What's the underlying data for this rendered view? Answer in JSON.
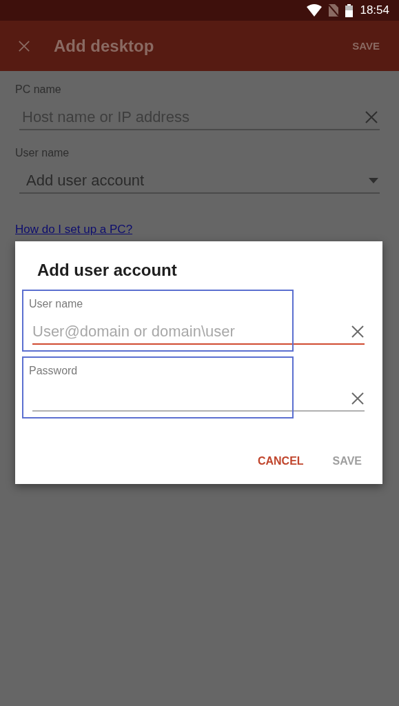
{
  "status_bar": {
    "time": "18:54"
  },
  "app_bar": {
    "title": "Add desktop",
    "action": "SAVE"
  },
  "form": {
    "fields": [
      {
        "kind": "text",
        "label": "PC name",
        "placeholder": "Host name or IP address"
      },
      {
        "kind": "dropdown",
        "label": "User name",
        "value": "Add user account"
      }
    ],
    "link": "How do I set up a PC?"
  },
  "dialog": {
    "title": "Add user account",
    "fields": [
      {
        "label": "User name",
        "placeholder": "User@domain or domain\\user",
        "focused": true,
        "highlighted": true
      },
      {
        "label": "Password",
        "focused": false,
        "highlighted": true
      }
    ],
    "buttons": [
      {
        "label": "CANCEL",
        "disabled": false
      },
      {
        "label": "SAVE",
        "disabled": true
      }
    ]
  }
}
